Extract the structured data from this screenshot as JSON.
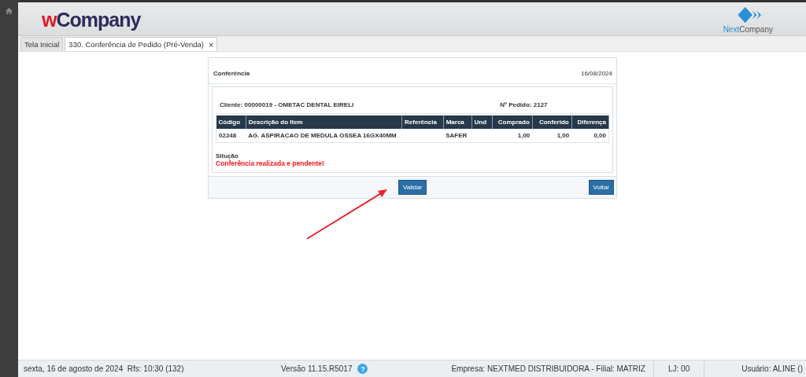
{
  "header": {
    "logo": {
      "accent": "w",
      "name": "Company"
    },
    "brand": {
      "accent": "Next",
      "name": "Company"
    }
  },
  "tabs": [
    {
      "label": "Tela Inicial",
      "selected": false
    },
    {
      "label": "330. Conferência de Pedido (Pré-Venda)",
      "selected": true,
      "close": "×"
    }
  ],
  "panel": {
    "title": "Conferência",
    "date": "16/08/2024",
    "client": "Cliente: 00000019 - OMETAC DENTAL EIRELI",
    "order": "Nº Pedido: 2127",
    "table": {
      "columns": [
        "Código",
        "Descrição do Item",
        "Referência",
        "Marca",
        "Und",
        "Comprado",
        "Conferido",
        "Diferença"
      ],
      "rows": [
        [
          "02248",
          "AG. ASPIRACAO DE MEDULA OSSEA 16GX40MM",
          "",
          "SAFER",
          "",
          "1,00",
          "1,00",
          "0,00"
        ]
      ]
    },
    "status_label": "Situção",
    "status_text": "Conferência realizada e pendente!",
    "buttons": [
      "Validar",
      "Voltar"
    ]
  },
  "annotation": {
    "kind": "arrow"
  },
  "status_bar": {
    "date": "sexta, 16 de agosto de 2024  Rfs: 10:30 (132)",
    "version": "Versão 11.15.R5017",
    "help": "?",
    "company": "Empresa: NEXTMED DISTRIBUIDORA - Filial: MATRIZ",
    "store": "LJ: 00",
    "user": "Usuário: ALINE ()"
  }
}
